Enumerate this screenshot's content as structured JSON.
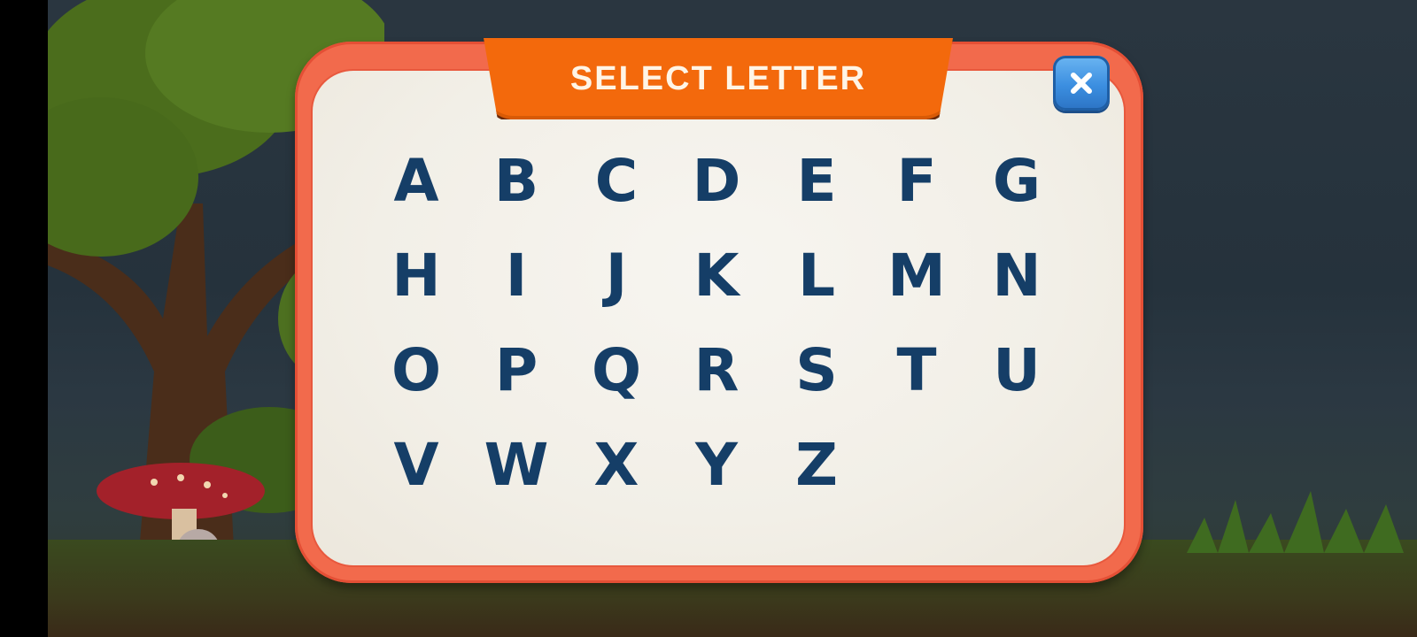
{
  "dialog": {
    "title": "SELECT LETTER",
    "close_icon": "close-x-icon"
  },
  "letters": [
    "A",
    "B",
    "C",
    "D",
    "E",
    "F",
    "G",
    "H",
    "I",
    "J",
    "K",
    "L",
    "M",
    "N",
    "O",
    "P",
    "Q",
    "R",
    "S",
    "T",
    "U",
    "V",
    "W",
    "X",
    "Y",
    "Z"
  ],
  "colors": {
    "letter": "#153e67",
    "panel_border": "#f26a4c",
    "title_tab": "#f3690c",
    "close_button": "#3b8ee0"
  }
}
